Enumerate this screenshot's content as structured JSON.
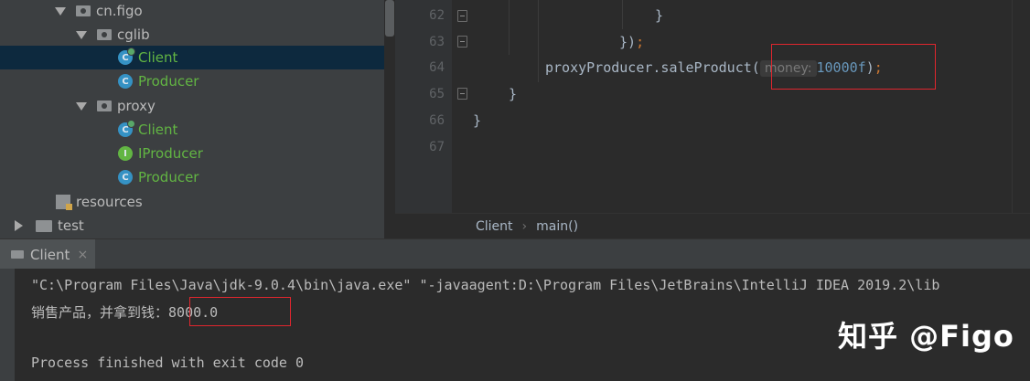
{
  "project_tree": {
    "items": [
      {
        "label": "cn.figo",
        "type": "package",
        "expanded": true
      },
      {
        "label": "cglib",
        "type": "package",
        "expanded": true
      },
      {
        "label": "Client",
        "type": "class",
        "icon": "C",
        "selected": true
      },
      {
        "label": "Producer",
        "type": "class",
        "icon": "C"
      },
      {
        "label": "proxy",
        "type": "package",
        "expanded": true
      },
      {
        "label": "Client",
        "type": "class",
        "icon": "C"
      },
      {
        "label": "IProducer",
        "type": "interface",
        "icon": "I"
      },
      {
        "label": "Producer",
        "type": "class",
        "icon": "C"
      },
      {
        "label": "resources",
        "type": "resources-folder"
      },
      {
        "label": "test",
        "type": "folder",
        "expanded": false
      }
    ]
  },
  "editor": {
    "line_numbers": [
      "62",
      "63",
      "64",
      "65",
      "66",
      "67"
    ],
    "lines": {
      "l62": "}",
      "l63_paren": "})",
      "l63_semi": ";",
      "l64_call": "proxyProducer.saleProduct(",
      "l64_hint": "money:",
      "l64_arg": "10000f",
      "l64_close": ")",
      "l64_semi": ";",
      "l65": "}",
      "l66": "}"
    }
  },
  "breadcrumb": {
    "items": [
      "Client",
      "main()"
    ],
    "separator": "›"
  },
  "run_panel": {
    "tab_label": "Client",
    "close_glyph": "×",
    "command_line": "\"C:\\Program Files\\Java\\jdk-9.0.4\\bin\\java.exe\" \"-javaagent:D:\\Program Files\\JetBrains\\IntelliJ IDEA 2019.2\\lib",
    "output_prefix": "销售产品，并拿到钱：",
    "output_value": "8000.0",
    "exit_message": "Process finished with exit code 0"
  },
  "watermark": "知乎 @Figo",
  "colors": {
    "tree_bg": "#3c3f41",
    "editor_bg": "#2b2b2b",
    "selection": "#0d293e",
    "highlight_box": "#e0262e",
    "keyword": "#cc7832",
    "number": "#6897bb"
  }
}
